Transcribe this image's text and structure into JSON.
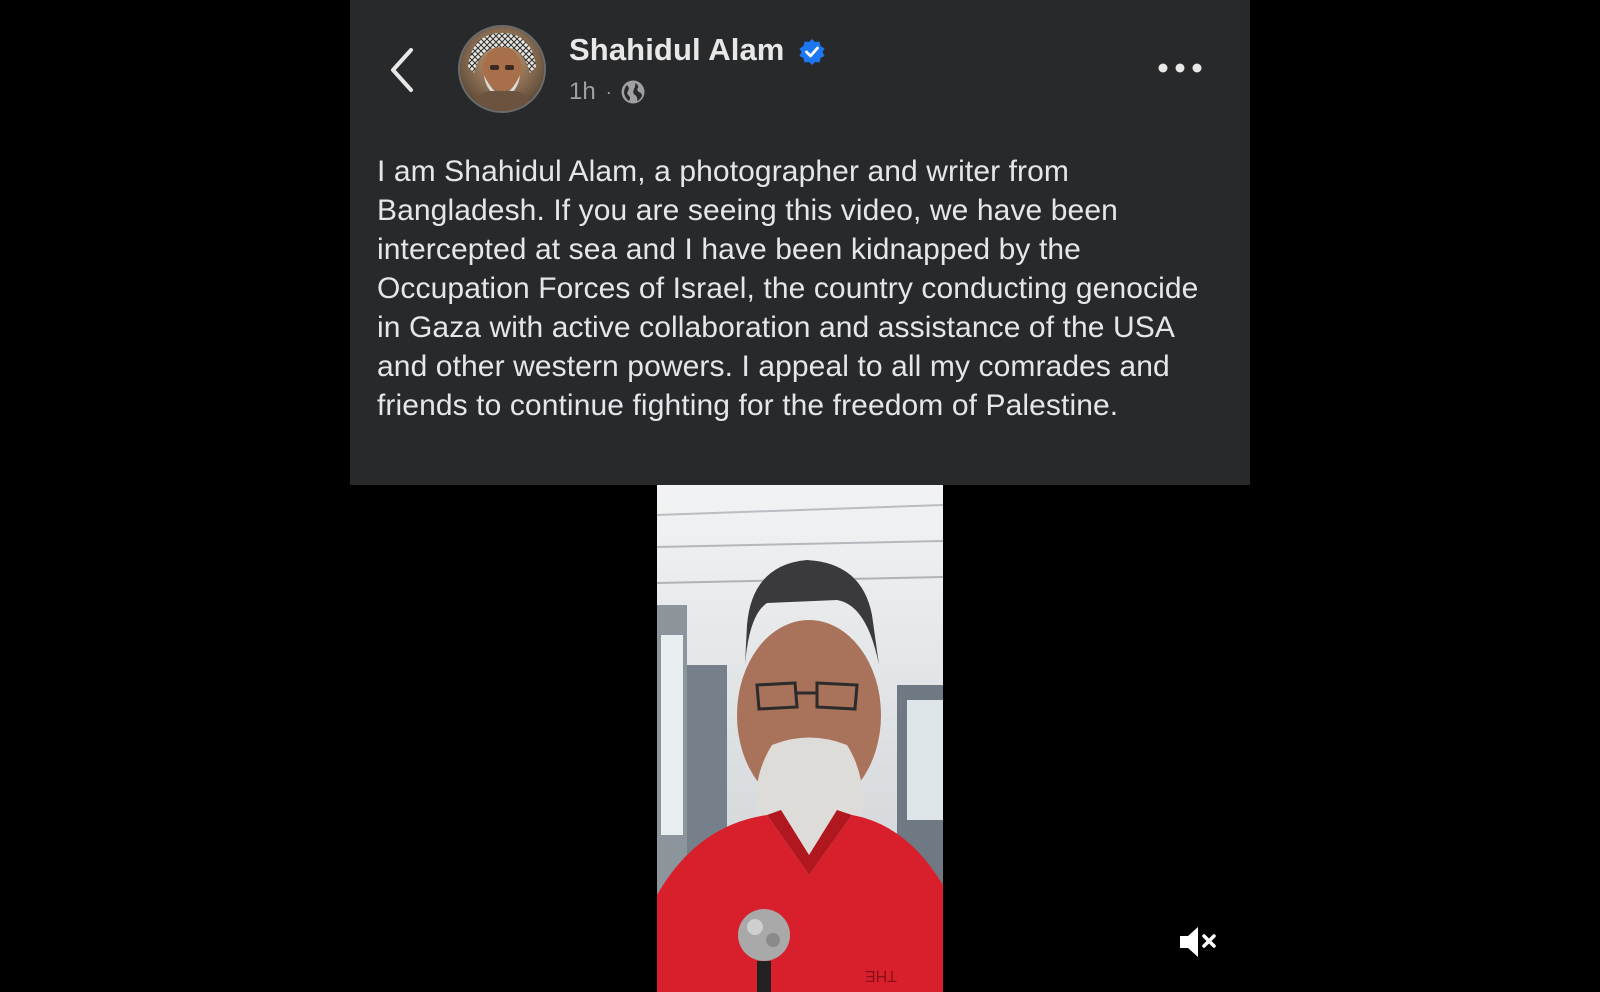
{
  "post": {
    "author_name": "Shahidul Alam",
    "verified": true,
    "timestamp": "1h",
    "separator": "·",
    "audience_icon": "globe-icon",
    "body": "I am Shahidul Alam, a photographer and writer from Bangladesh. If you are seeing this video, we have been intercepted at sea and I have been kidnapped by the Occupation Forces of Israel, the country conducting genocide in Gaza with active collaboration and assistance of the USA and other western powers. I appeal to all my comrades and friends to continue fighting for the freedom of Palestine."
  },
  "navigation": {
    "back_icon": "chevron-left-icon",
    "more_icon": "more-horizontal-icon"
  },
  "video": {
    "muted": true,
    "mute_icon": "speaker-muted-icon"
  },
  "colors": {
    "card_background": "#28292b",
    "page_background": "#000000",
    "text_primary": "#e4e6eb",
    "text_secondary": "#a0a0a2",
    "verified_badge": "#1d77f2"
  }
}
